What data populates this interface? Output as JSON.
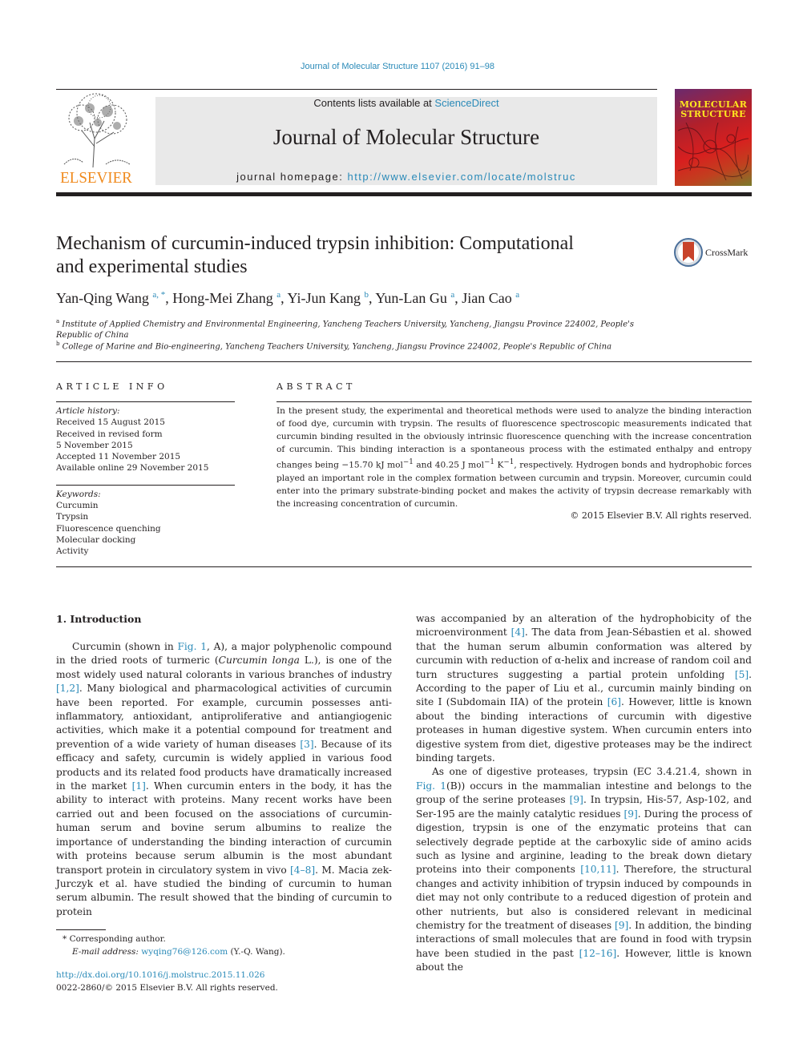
{
  "header": {
    "citation": "Journal of Molecular Structure 1107 (2016) 91–98",
    "publisher_logo_text": "ELSEVIER",
    "contents_prefix": "Contents lists available at ",
    "contents_link": "ScienceDirect",
    "journal_title": "Journal of Molecular Structure",
    "homepage_label": "journal homepage: ",
    "homepage_url": "http://www.elsevier.com/locate/molstruc",
    "cover_title_line1": "MOLECULAR",
    "cover_title_line2": "STRUCTURE"
  },
  "article": {
    "title_line1": "Mechanism of curcumin-induced trypsin inhibition: Computational",
    "title_line2": "and experimental studies",
    "crossmark_label": "CrossMark",
    "authors": [
      {
        "name": "Yan-Qing Wang",
        "sup": "a, *"
      },
      {
        "name": "Hong-Mei Zhang",
        "sup": "a"
      },
      {
        "name": "Yi-Jun Kang",
        "sup": "b"
      },
      {
        "name": "Yun-Lan Gu",
        "sup": "a"
      },
      {
        "name": "Jian Cao",
        "sup": "a"
      }
    ],
    "affiliations": [
      {
        "mark": "a",
        "text": "Institute of Applied Chemistry and Environmental Engineering, Yancheng Teachers University, Yancheng, Jiangsu Province 224002, People's Republic of China"
      },
      {
        "mark": "b",
        "text": "College of Marine and Bio-engineering, Yancheng Teachers University, Yancheng, Jiangsu Province 224002, People's Republic of China"
      }
    ]
  },
  "article_info": {
    "heading": "ARTICLE INFO",
    "history_label": "Article history:",
    "history": [
      "Received 15 August 2015",
      "Received in revised form",
      "5 November 2015",
      "Accepted 11 November 2015",
      "Available online 29 November 2015"
    ],
    "keywords_label": "Keywords:",
    "keywords": [
      "Curcumin",
      "Trypsin",
      "Fluorescence quenching",
      "Molecular docking",
      "Activity"
    ]
  },
  "abstract": {
    "heading": "ABSTRACT",
    "text_part1": "In the present study, the experimental and theoretical methods were used to analyze the binding interaction of food dye, curcumin with trypsin. The results of fluorescence spectroscopic measurements indicated that curcumin binding resulted in the obviously intrinsic fluorescence quenching with the increase concentration of curcumin. This binding interaction is a spontaneous process with the estimated enthalpy and entropy changes being −15.70 kJ mol",
    "sup1": "−1",
    "text_part2": " and 40.25 J mol",
    "sup2": "−1",
    "text_part3": " K",
    "sup3": "−1",
    "text_part4": ", respectively. Hydrogen bonds and hydrophobic forces played an important role in the complex formation between curcumin and trypsin. Moreover, curcumin could enter into the primary substrate-binding pocket and makes the activity of trypsin decrease remarkably with the increasing concentration of curcumin.",
    "copyright": "© 2015 Elsevier B.V. All rights reserved."
  },
  "introduction": {
    "heading": "1.  Introduction",
    "left_para": [
      {
        "t": "Curcumin (shown in "
      },
      {
        "t": "Fig. 1",
        "link": true
      },
      {
        "t": ", A), a major polyphenolic compound in the dried roots of turmeric ("
      },
      {
        "t": "Curcumin longa",
        "italic": true
      },
      {
        "t": " L.), is one of the most widely used natural colorants in various branches of industry "
      },
      {
        "t": "[1,2]",
        "link": true
      },
      {
        "t": ". Many biological and pharmacological activities of curcumin have been reported. For example, curcumin possesses anti-inflammatory, antioxidant, antiproliferative and antiangiogenic activities, which make it a potential compound for treatment and prevention of a wide variety of human diseases "
      },
      {
        "t": "[3]",
        "link": true
      },
      {
        "t": ". Because of its efficacy and safety, curcumin is widely applied in various food products and its related food products have dramatically increased in the market "
      },
      {
        "t": "[1]",
        "link": true
      },
      {
        "t": ". When curcumin enters in the body, it has the ability to interact with proteins. Many recent works have been carried out and been focused on the associations of curcumin-human serum and bovine serum albumins to realize the importance of understanding the binding interaction of curcumin with proteins because serum albumin is the most abundant transport protein in circulatory system in vivo "
      },
      {
        "t": "[4–8]",
        "link": true
      },
      {
        "t": ". M. Macia zek-Jurczyk et al. have studied the binding of curcumin to human serum albumin. The result showed that the binding of curcumin to protein"
      }
    ],
    "right_para1": [
      {
        "t": "was accompanied by an alteration of the hydrophobicity of the microenvironment "
      },
      {
        "t": "[4]",
        "link": true
      },
      {
        "t": ". The data from Jean-Sébastien et al. showed that the human serum albumin conformation was altered by curcumin with reduction of α-helix and increase of random coil and turn structures suggesting a partial protein unfolding "
      },
      {
        "t": "[5]",
        "link": true
      },
      {
        "t": ". According to the paper of Liu et al., curcumin mainly binding on site I (Subdomain IIA) of the protein "
      },
      {
        "t": "[6]",
        "link": true
      },
      {
        "t": ". However, little is known about the binding interactions of curcumin with digestive proteases in human digestive system. When curcumin enters into digestive system from diet, digestive proteases may be the indirect binding targets."
      }
    ],
    "right_para2": [
      {
        "t": "As one of digestive proteases, trypsin (EC 3.4.21.4, shown in "
      },
      {
        "t": "Fig. 1",
        "link": true
      },
      {
        "t": "(B)) occurs in the mammalian intestine and belongs to the group of the serine proteases "
      },
      {
        "t": "[9]",
        "link": true
      },
      {
        "t": ". In trypsin, His-57, Asp-102, and Ser-195 are the mainly catalytic residues "
      },
      {
        "t": "[9]",
        "link": true
      },
      {
        "t": ". During the process of digestion, trypsin is one of the enzymatic proteins that can selectively degrade peptide at the carboxylic side of amino acids such as lysine and arginine, leading to the break down dietary proteins into their components "
      },
      {
        "t": "[10,11]",
        "link": true
      },
      {
        "t": ". Therefore, the structural changes and activity inhibition of trypsin induced by compounds in diet may not only contribute to a reduced digestion of protein and other nutrients, but also is considered relevant in medicinal chemistry for the treatment of diseases "
      },
      {
        "t": "[9]",
        "link": true
      },
      {
        "t": ". In addition, the binding interactions of small molecules that are found in food with trypsin have been studied in the past "
      },
      {
        "t": "[12–16]",
        "link": true
      },
      {
        "t": ". However, little is known about the"
      }
    ]
  },
  "footnotes": {
    "corresponding_mark": "*",
    "corresponding_text": "Corresponding author.",
    "email_label": "E-mail address: ",
    "email": "wyqing76@126.com",
    "email_suffix": " (Y.-Q. Wang).",
    "doi": "http://dx.doi.org/10.1016/j.molstruc.2015.11.026",
    "issn_copyright": "0022-2860/© 2015 Elsevier B.V. All rights reserved."
  }
}
